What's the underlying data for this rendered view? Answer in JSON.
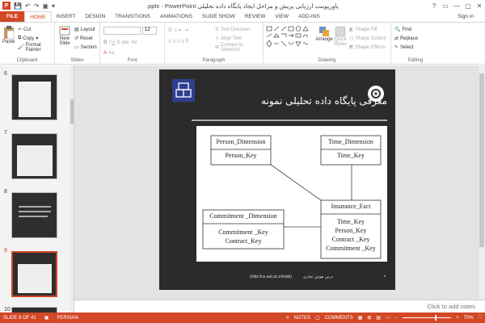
{
  "titlebar": {
    "title": ".pptx - PowerPoint پاورپوینت ارزیابی پریش و مراحل ایجاد پایگاه داده تحلیلی",
    "window_controls": [
      "?",
      "▭",
      "—",
      "▢",
      "✕"
    ]
  },
  "tabs": [
    "FILE",
    "HOME",
    "INSERT",
    "DESIGN",
    "TRANSITIONS",
    "ANIMATIONS",
    "SLIDE SHOW",
    "REVIEW",
    "VIEW",
    "ADD-INS"
  ],
  "active_tab": "HOME",
  "sign_in": "Sign in",
  "ribbon": {
    "clipboard": {
      "paste": "Paste",
      "cut": "Cut",
      "copy": "Copy",
      "format_painter": "Format Painter",
      "name": "Clipboard"
    },
    "slides": {
      "new_slide": "New Slide",
      "layout": "Layout",
      "reset": "Reset",
      "section": "Section",
      "name": "Slides"
    },
    "font": {
      "size": "12",
      "name": "Font"
    },
    "paragraph": {
      "text_direction": "Text Direction",
      "align_text": "Align Text",
      "convert": "Convert to SmartArt",
      "name": "Paragraph"
    },
    "drawing": {
      "arrange": "Arrange",
      "quick_styles": "Quick Styles",
      "shape_fill": "Shape Fill",
      "shape_outline": "Shape Outline",
      "shape_effects": "Shape Effects",
      "name": "Drawing"
    },
    "editing": {
      "find": "Find",
      "replace": "Replace",
      "select": "Select",
      "name": "Editing"
    }
  },
  "thumbnails": [
    {
      "num": "6"
    },
    {
      "num": "7"
    },
    {
      "num": "8"
    },
    {
      "num": "9",
      "selected": true
    },
    {
      "num": "10"
    }
  ],
  "slide": {
    "title": "معرفی پایگاه داده تحلیلی نمونه",
    "footer_url": "(http://ce.aut.ac.ir/islab)",
    "footer_text": "درس هوش تجاری",
    "entities": {
      "person": {
        "name": "Person_Dimension",
        "key": "Person_Key"
      },
      "time": {
        "name": "Time_Dimension",
        "key": "Time_Key"
      },
      "insurance": {
        "name": "Insurance_Fact",
        "keys": [
          "Time_Key",
          "Person_Key",
          "Contract _Key",
          "Commitment _Key"
        ]
      },
      "commitment": {
        "name": "Commitment _Dimension",
        "keys": [
          "Commitment _Key",
          "Contract_Key"
        ]
      }
    }
  },
  "notes": "Click to add notes",
  "status": {
    "slide_of": "SLIDE 9 OF 41",
    "language": "PERSIAN",
    "notes": "NOTES",
    "comments": "COMMENTS",
    "zoom": "70%"
  },
  "colors": {
    "accent": "#d24726",
    "slide_bg": "#2b2b2b"
  }
}
